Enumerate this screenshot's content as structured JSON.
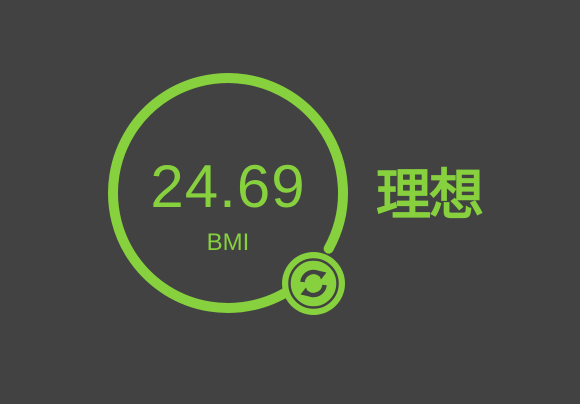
{
  "bmi": {
    "value": "24.69",
    "label": "BMI",
    "status": "理想"
  },
  "gauge": {
    "level": 0.93
  },
  "icons": {
    "refresh": "refresh-icon"
  },
  "colors": {
    "background": "#424242",
    "accent": "#86d13d"
  }
}
